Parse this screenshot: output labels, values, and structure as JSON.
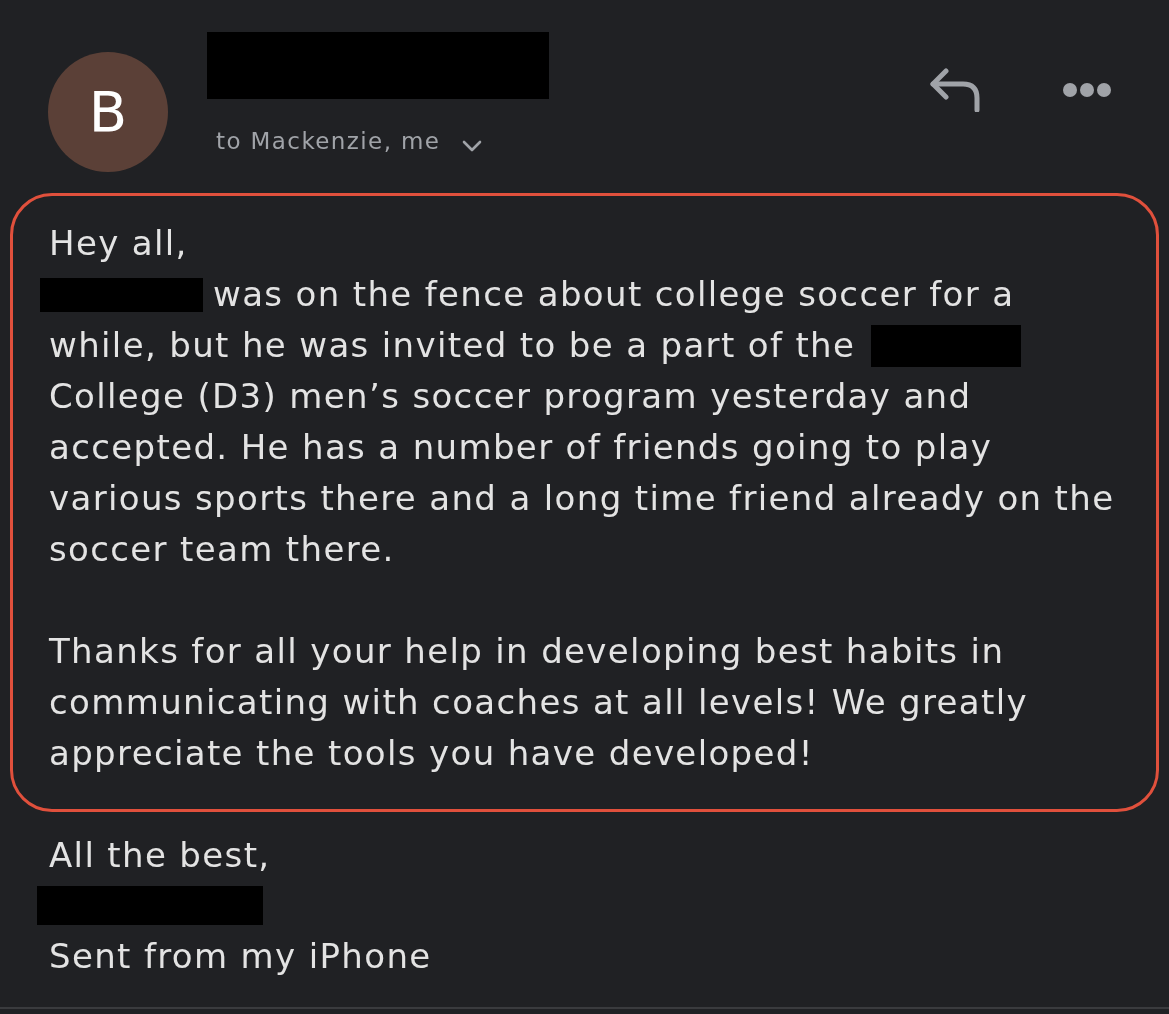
{
  "header": {
    "avatar_letter": "B",
    "sender": {
      "redacted": true
    },
    "recipients": "to Mackenzie, me",
    "details_expanded": false
  },
  "body": {
    "highlighted": true,
    "paragraphs": [
      {
        "lines": [
          [
            {
              "kind": "text",
              "text": "Hey all,"
            }
          ],
          [
            {
              "kind": "redaction"
            },
            {
              "kind": "text",
              "text": "was on the fence about college soccer for a"
            }
          ],
          [
            {
              "kind": "text",
              "text": "while, but he was invited to be a part of the"
            },
            {
              "kind": "redaction"
            }
          ],
          [
            {
              "kind": "text",
              "text": "College (D3) men’s soccer program yesterday and"
            }
          ],
          [
            {
              "kind": "text",
              "text": "accepted. He has a number of friends going to play"
            }
          ],
          [
            {
              "kind": "text",
              "text": "various sports there and a long time friend already on the"
            }
          ],
          [
            {
              "kind": "text",
              "text": "soccer team there."
            }
          ]
        ]
      },
      {
        "lines": [
          [
            {
              "kind": "text",
              "text": "Thanks for all your help in developing best habits in"
            }
          ],
          [
            {
              "kind": "text",
              "text": "communicating with coaches at all levels! We greatly"
            }
          ],
          [
            {
              "kind": "text",
              "text": "appreciate the tools you have developed!"
            }
          ]
        ]
      }
    ]
  },
  "signature": {
    "closing": "All the best,",
    "name": {
      "redacted": true
    },
    "footer": "Sent from my iPhone"
  }
}
